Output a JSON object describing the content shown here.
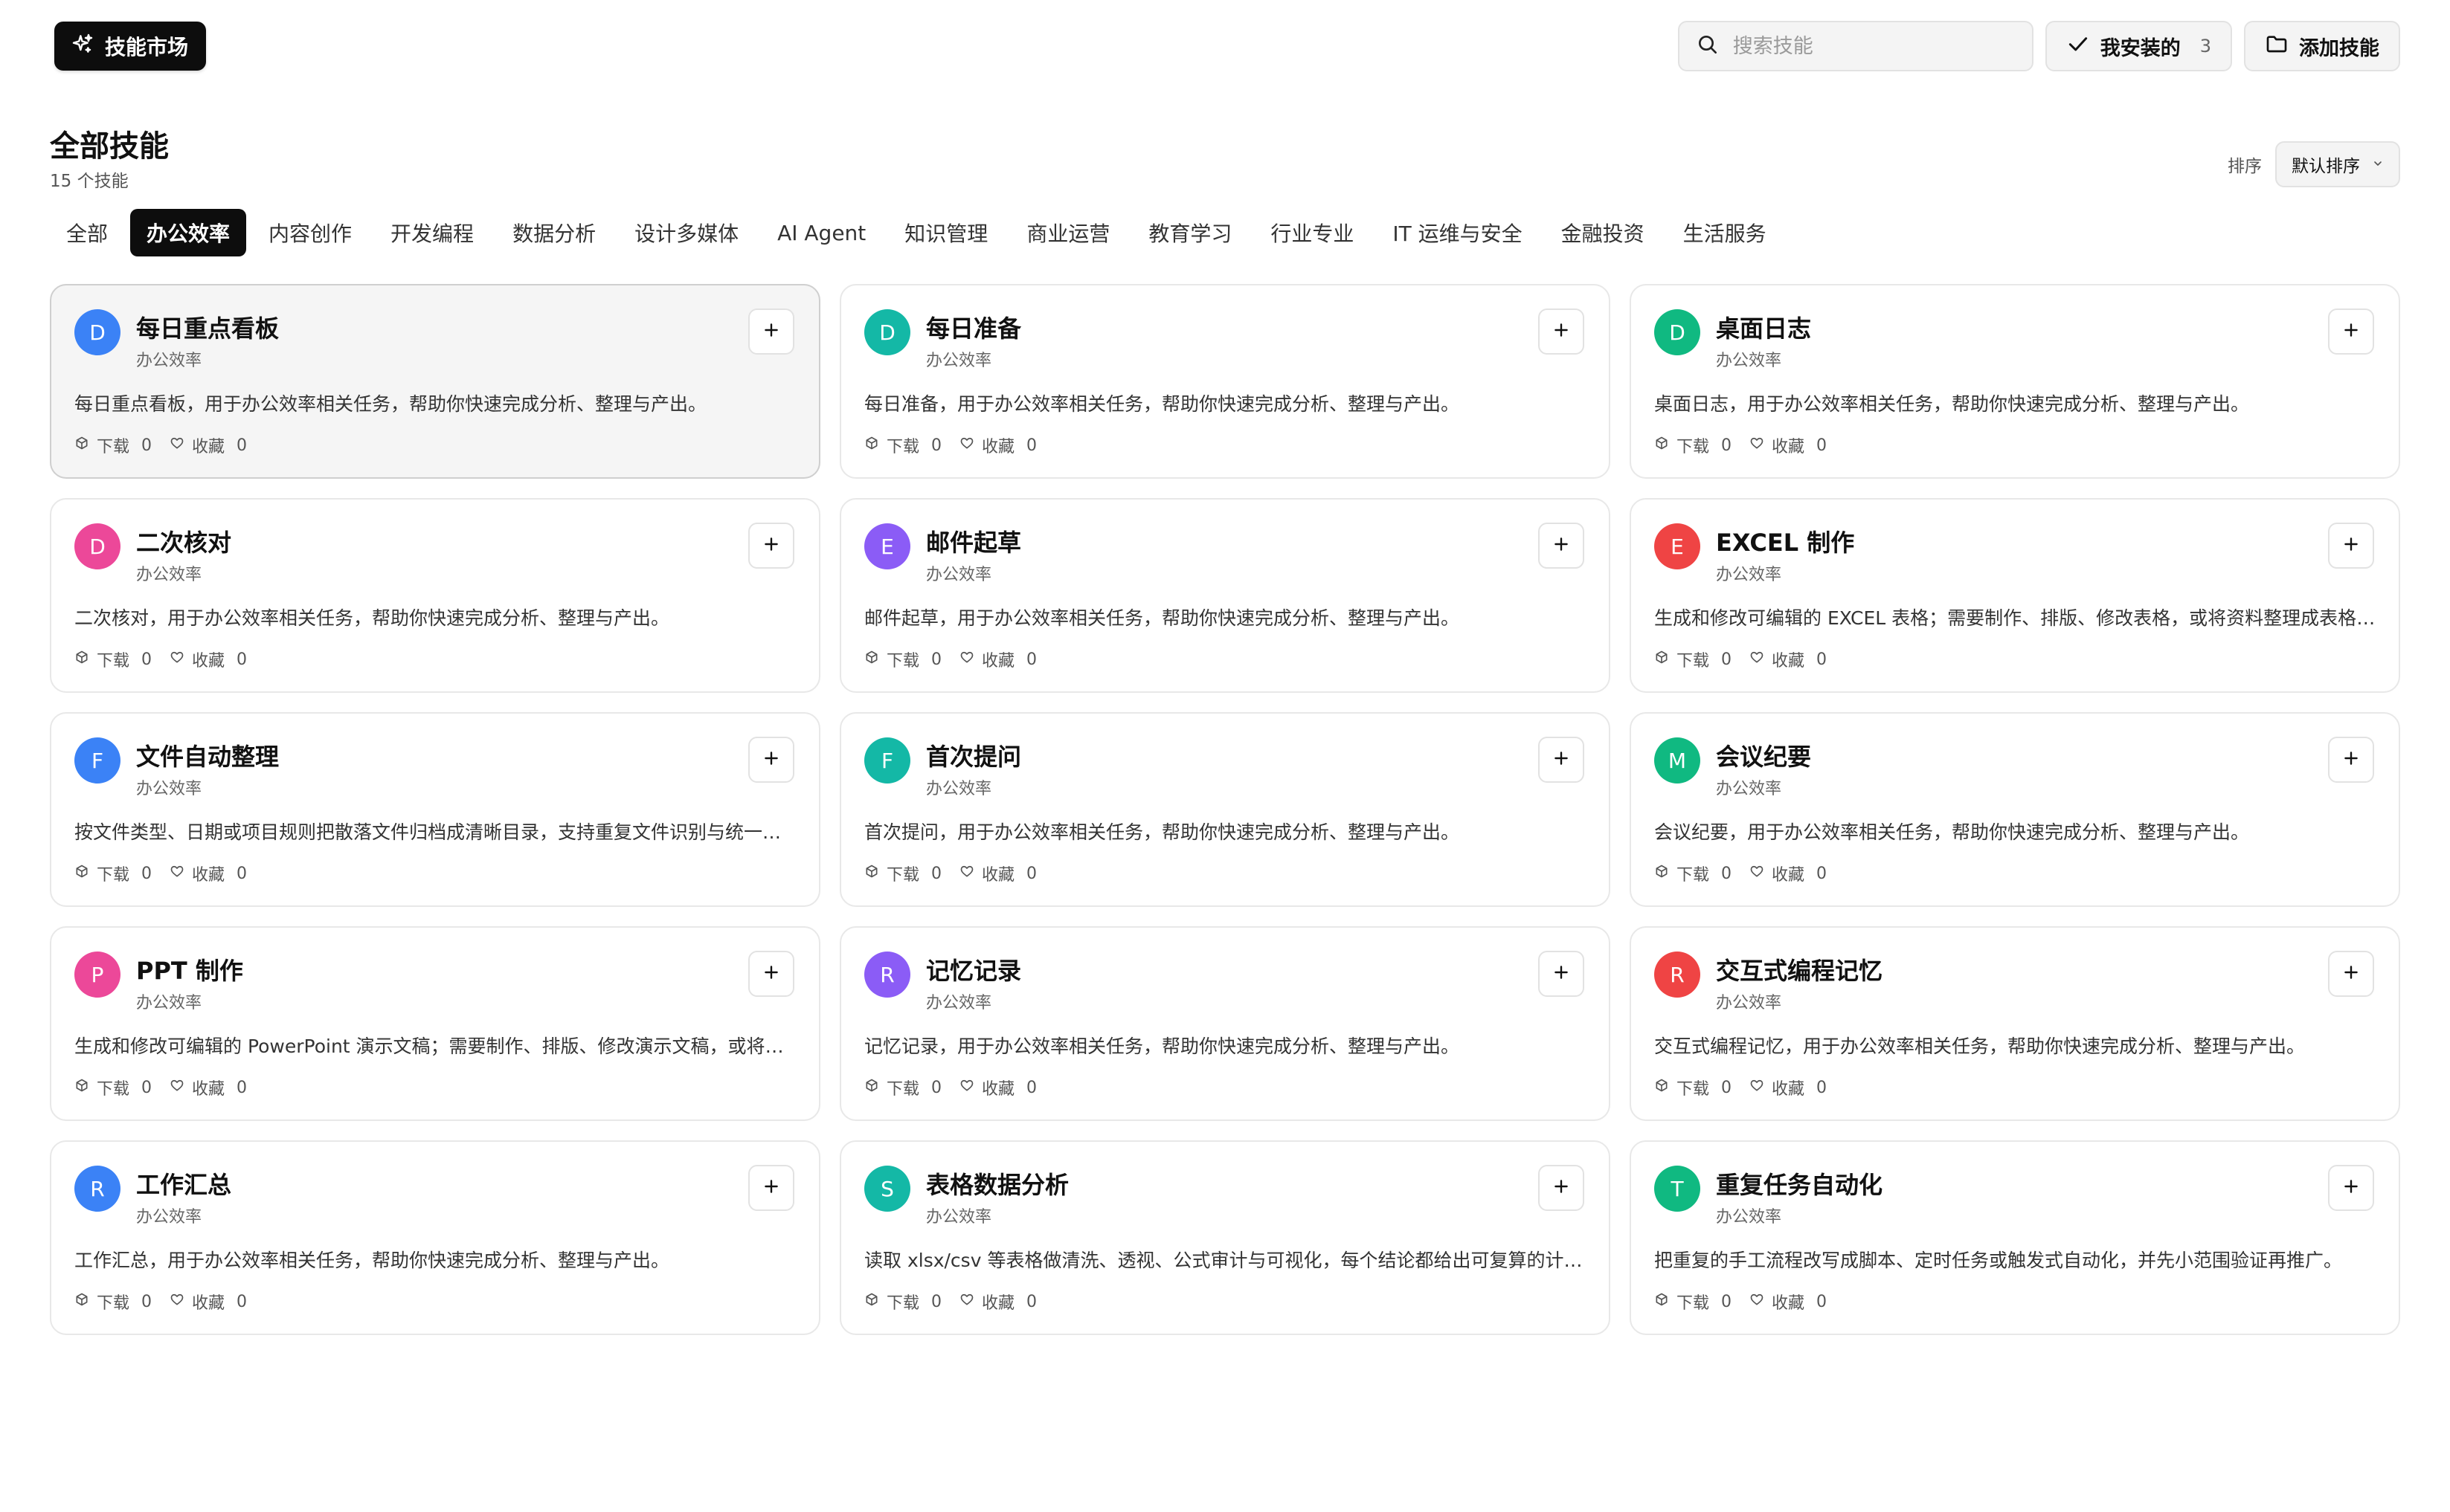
{
  "header": {
    "brand_label": "技能市场",
    "search_placeholder": "搜索技能",
    "installed_label": "我安装的",
    "installed_count": "3",
    "add_skill_label": "添加技能"
  },
  "page": {
    "title": "全部技能",
    "subtitle": "15 个技能",
    "sort_label": "排序",
    "sort_value": "默认排序"
  },
  "tabs": [
    {
      "label": "全部",
      "active": false
    },
    {
      "label": "办公效率",
      "active": true
    },
    {
      "label": "内容创作",
      "active": false
    },
    {
      "label": "开发编程",
      "active": false
    },
    {
      "label": "数据分析",
      "active": false
    },
    {
      "label": "设计多媒体",
      "active": false
    },
    {
      "label": "AI Agent",
      "active": false
    },
    {
      "label": "知识管理",
      "active": false
    },
    {
      "label": "商业运营",
      "active": false
    },
    {
      "label": "教育学习",
      "active": false
    },
    {
      "label": "行业专业",
      "active": false
    },
    {
      "label": "IT 运维与安全",
      "active": false
    },
    {
      "label": "金融投资",
      "active": false
    },
    {
      "label": "生活服务",
      "active": false
    }
  ],
  "card_labels": {
    "download": "下载",
    "favorite": "收藏"
  },
  "cards": [
    {
      "initial": "D",
      "color": "#3b82f6",
      "title": "每日重点看板",
      "category": "办公效率",
      "description": "每日重点看板，用于办公效率相关任务，帮助你快速完成分析、整理与产出。",
      "downloads": "0",
      "favorites": "0",
      "hovered": true
    },
    {
      "initial": "D",
      "color": "#14b8a6",
      "title": "每日准备",
      "category": "办公效率",
      "description": "每日准备，用于办公效率相关任务，帮助你快速完成分析、整理与产出。",
      "downloads": "0",
      "favorites": "0"
    },
    {
      "initial": "D",
      "color": "#10b981",
      "title": "桌面日志",
      "category": "办公效率",
      "description": "桌面日志，用于办公效率相关任务，帮助你快速完成分析、整理与产出。",
      "downloads": "0",
      "favorites": "0"
    },
    {
      "initial": "D",
      "color": "#ec4899",
      "title": "二次核对",
      "category": "办公效率",
      "description": "二次核对，用于办公效率相关任务，帮助你快速完成分析、整理与产出。",
      "downloads": "0",
      "favorites": "0"
    },
    {
      "initial": "E",
      "color": "#8b5cf6",
      "title": "邮件起草",
      "category": "办公效率",
      "description": "邮件起草，用于办公效率相关任务，帮助你快速完成分析、整理与产出。",
      "downloads": "0",
      "favorites": "0"
    },
    {
      "initial": "E",
      "color": "#ef4444",
      "title": "EXCEL 制作",
      "category": "办公效率",
      "description": "生成和修改可编辑的 EXCEL 表格；需要制作、排版、修改表格，或将资料整理成表格时使用。",
      "downloads": "0",
      "favorites": "0"
    },
    {
      "initial": "F",
      "color": "#3b82f6",
      "title": "文件自动整理",
      "category": "办公效率",
      "description": "按文件类型、日期或项目规则把散落文件归档成清晰目录，支持重复文件识别与统一命名。",
      "downloads": "0",
      "favorites": "0"
    },
    {
      "initial": "F",
      "color": "#14b8a6",
      "title": "首次提问",
      "category": "办公效率",
      "description": "首次提问，用于办公效率相关任务，帮助你快速完成分析、整理与产出。",
      "downloads": "0",
      "favorites": "0"
    },
    {
      "initial": "M",
      "color": "#10b981",
      "title": "会议纪要",
      "category": "办公效率",
      "description": "会议纪要，用于办公效率相关任务，帮助你快速完成分析、整理与产出。",
      "downloads": "0",
      "favorites": "0"
    },
    {
      "initial": "P",
      "color": "#ec4899",
      "title": "PPT 制作",
      "category": "办公效率",
      "description": "生成和修改可编辑的 PowerPoint 演示文稿；需要制作、排版、修改演示文稿，或将资料整理成幻灯片时使用。",
      "downloads": "0",
      "favorites": "0"
    },
    {
      "initial": "R",
      "color": "#8b5cf6",
      "title": "记忆记录",
      "category": "办公效率",
      "description": "记忆记录，用于办公效率相关任务，帮助你快速完成分析、整理与产出。",
      "downloads": "0",
      "favorites": "0"
    },
    {
      "initial": "R",
      "color": "#ef4444",
      "title": "交互式编程记忆",
      "category": "办公效率",
      "description": "交互式编程记忆，用于办公效率相关任务，帮助你快速完成分析、整理与产出。",
      "downloads": "0",
      "favorites": "0"
    },
    {
      "initial": "R",
      "color": "#3b82f6",
      "title": "工作汇总",
      "category": "办公效率",
      "description": "工作汇总，用于办公效率相关任务，帮助你快速完成分析、整理与产出。",
      "downloads": "0",
      "favorites": "0"
    },
    {
      "initial": "S",
      "color": "#14b8a6",
      "title": "表格数据分析",
      "category": "办公效率",
      "description": "读取 xlsx/csv 等表格做清洗、透视、公式审计与可视化，每个结论都给出可复算的计算过程。",
      "downloads": "0",
      "favorites": "0"
    },
    {
      "initial": "T",
      "color": "#10b981",
      "title": "重复任务自动化",
      "category": "办公效率",
      "description": "把重复的手工流程改写成脚本、定时任务或触发式自动化，并先小范围验证再推广。",
      "downloads": "0",
      "favorites": "0"
    }
  ]
}
